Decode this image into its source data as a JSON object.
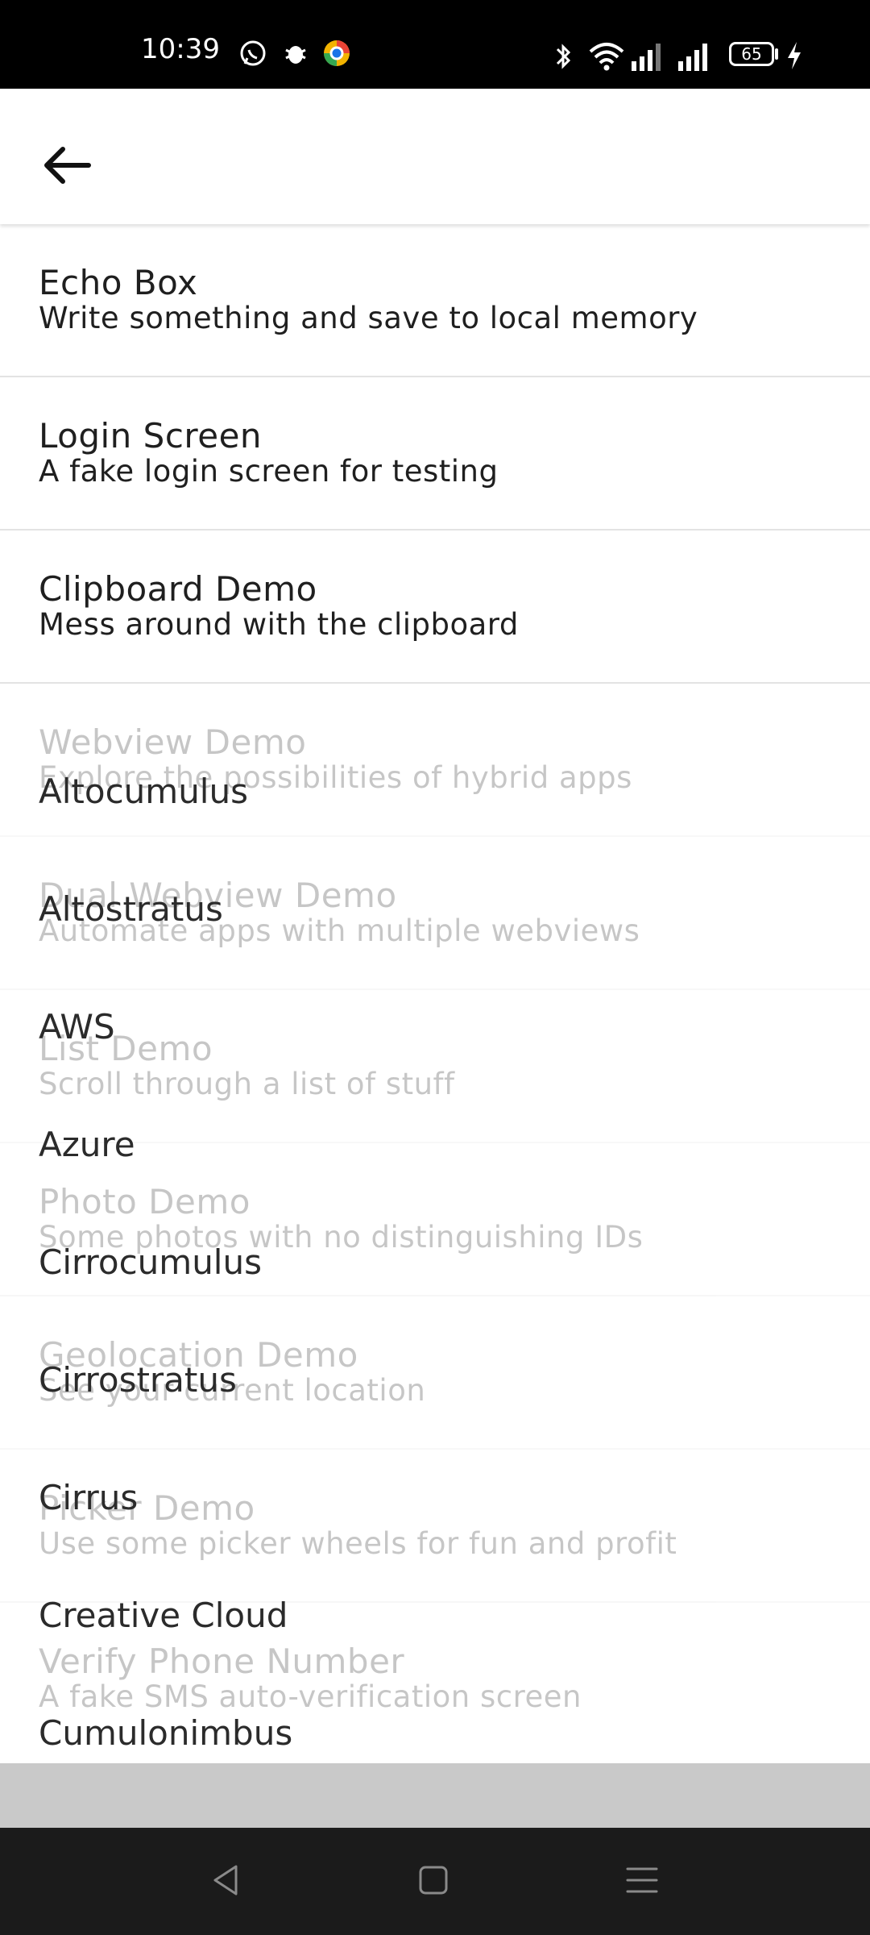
{
  "status_bar": {
    "time": "10:39",
    "battery": "65",
    "app_icons": [
      "whatsapp-icon",
      "bug-icon",
      "chrome-like-icon"
    ],
    "system_icons": [
      "bluetooth-icon",
      "wifi-icon",
      "signal-icon",
      "signal-icon",
      "battery-icon",
      "charging-icon"
    ]
  },
  "header": {
    "back_icon": "arrow-left-icon"
  },
  "demos": [
    {
      "title": "Echo Box",
      "subtitle": "Write something and save to local memory"
    },
    {
      "title": "Login Screen",
      "subtitle": "A fake login screen for testing"
    },
    {
      "title": "Clipboard Demo",
      "subtitle": "Mess around with the clipboard"
    },
    {
      "title": "Webview Demo",
      "subtitle": "Explore the possibilities of hybrid apps"
    },
    {
      "title": "Dual Webview Demo",
      "subtitle": "Automate apps with multiple webviews"
    },
    {
      "title": "List Demo",
      "subtitle": "Scroll through a list of stuff"
    },
    {
      "title": "Photo Demo",
      "subtitle": "Some photos with no distinguishing IDs"
    },
    {
      "title": "Geolocation Demo",
      "subtitle": "See your current location"
    },
    {
      "title": "Picker Demo",
      "subtitle": "Use some picker wheels for fun and profit"
    },
    {
      "title": "Verify Phone Number",
      "subtitle": "A fake SMS auto-verification screen"
    }
  ],
  "cloud_list": [
    "Altocumulus",
    "Altostratus",
    "AWS",
    "Azure",
    "Cirrocumulus",
    "Cirrostratus",
    "Cirrus",
    "Creative Cloud",
    "Cumulonimbus"
  ],
  "nav_bar": {
    "back": "triangle-back-icon",
    "home": "square-home-icon",
    "menu": "hamburger-menu-icon"
  }
}
